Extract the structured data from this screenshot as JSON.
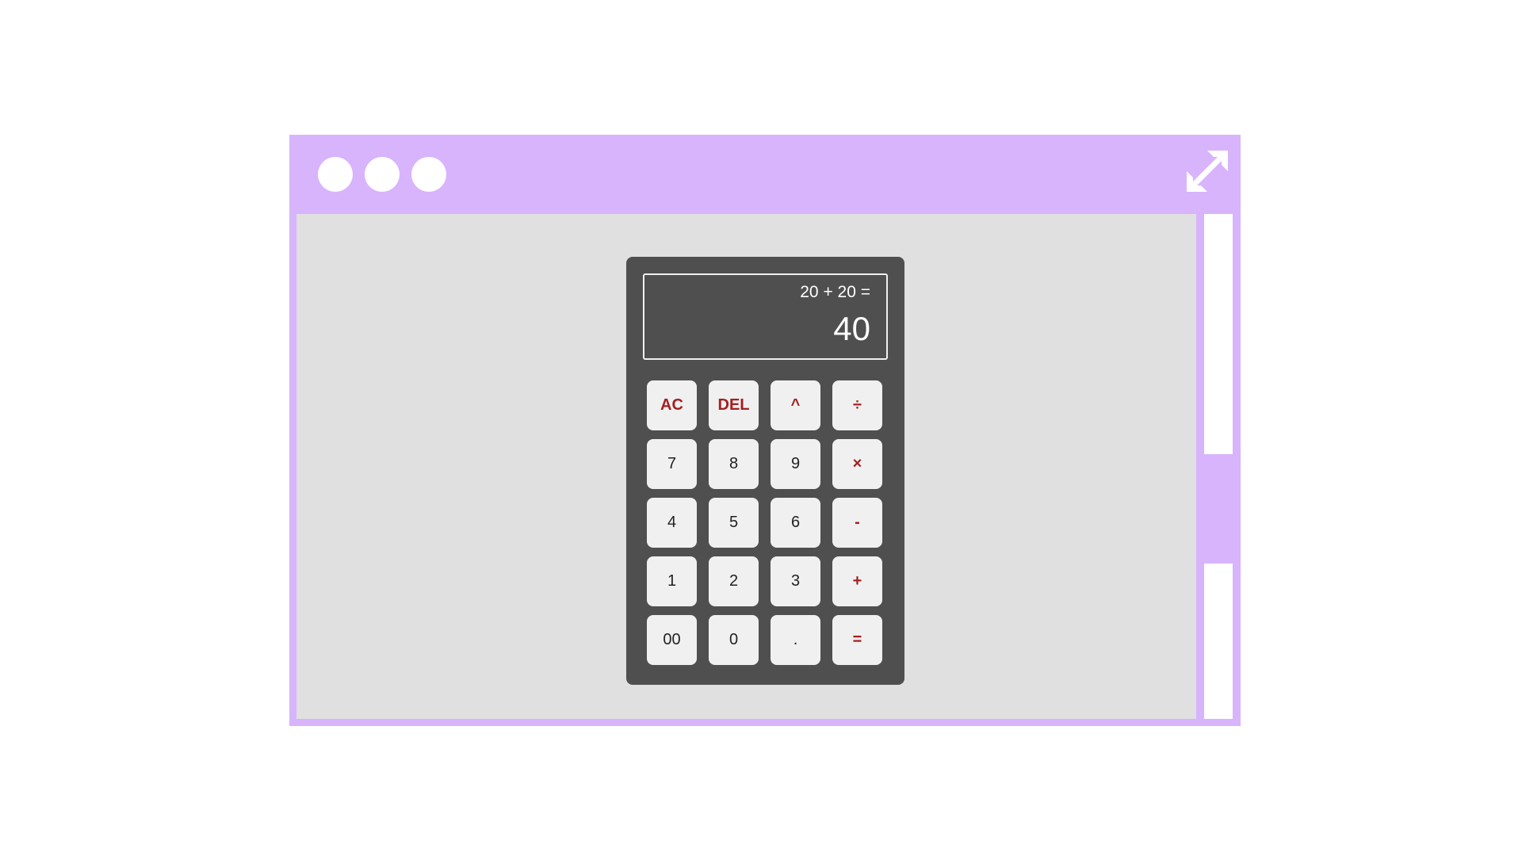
{
  "window": {
    "controls": [
      "window-dot",
      "window-dot",
      "window-dot"
    ],
    "expand_icon": "expand-arrows-icon"
  },
  "colors": {
    "frame": "#d8b4fc",
    "content_bg": "#e0e0e0",
    "calculator_bg": "#4f4f4f",
    "key_bg": "#f0f0f0",
    "operator_text": "#a32020"
  },
  "calculator": {
    "expression": "20 + 20 =",
    "result": "40",
    "keys": [
      {
        "label": "AC",
        "kind": "operator"
      },
      {
        "label": "DEL",
        "kind": "operator"
      },
      {
        "label": "^",
        "kind": "operator"
      },
      {
        "label": "÷",
        "kind": "operator"
      },
      {
        "label": "7",
        "kind": "digit"
      },
      {
        "label": "8",
        "kind": "digit"
      },
      {
        "label": "9",
        "kind": "digit"
      },
      {
        "label": "×",
        "kind": "operator"
      },
      {
        "label": "4",
        "kind": "digit"
      },
      {
        "label": "5",
        "kind": "digit"
      },
      {
        "label": "6",
        "kind": "digit"
      },
      {
        "label": "-",
        "kind": "operator"
      },
      {
        "label": "1",
        "kind": "digit"
      },
      {
        "label": "2",
        "kind": "digit"
      },
      {
        "label": "3",
        "kind": "digit"
      },
      {
        "label": "+",
        "kind": "operator"
      },
      {
        "label": "00",
        "kind": "digit"
      },
      {
        "label": "0",
        "kind": "digit"
      },
      {
        "label": ".",
        "kind": "digit"
      },
      {
        "label": "=",
        "kind": "operator"
      }
    ]
  }
}
